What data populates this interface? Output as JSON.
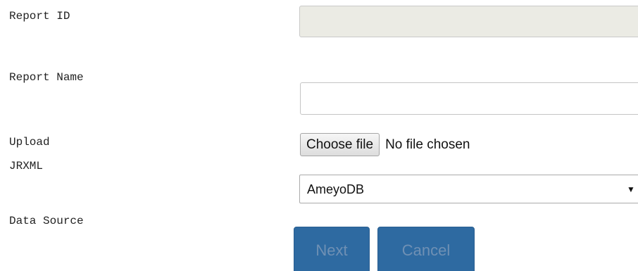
{
  "form": {
    "report_id": {
      "label": "Report ID",
      "value": ""
    },
    "report_name": {
      "label": "Report Name",
      "value": ""
    },
    "upload": {
      "label_line1": "Upload",
      "label_line2": "JRXML",
      "button_label": "Choose file",
      "status_text": "No file chosen"
    },
    "data_source": {
      "label": "Data Source",
      "selected_value": "AmeyoDB",
      "arrow_glyph": "▼"
    }
  },
  "actions": {
    "next_label": "Next",
    "cancel_label": "Cancel",
    "button_color": "#2e6aa1"
  }
}
